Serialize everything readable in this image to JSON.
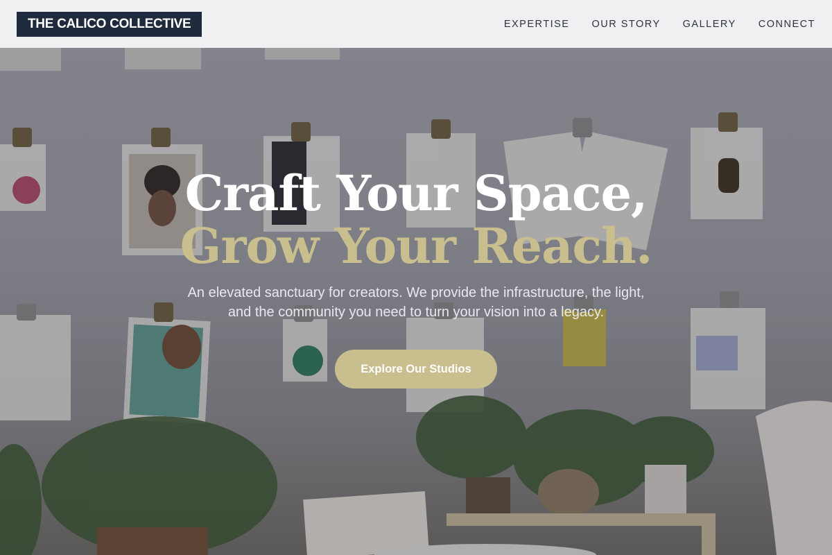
{
  "header": {
    "logo": "THE CALICO COLLECTIVE",
    "nav": [
      "EXPERTISE",
      "OUR STORY",
      "GALLERY",
      "CONNECT"
    ]
  },
  "hero": {
    "title_line1": "Craft Your Space,",
    "title_line2": "Grow Your Reach.",
    "subtitle": "An elevated sanctuary for creators. We provide the infrastructure, the light, and the community you need to turn your vision into a legacy.",
    "cta_label": "Explore Our Studios"
  },
  "colors": {
    "logo_bg": "#1f2a3c",
    "accent_gold": "#c8be8e",
    "header_bg": "#f5f5f7"
  }
}
